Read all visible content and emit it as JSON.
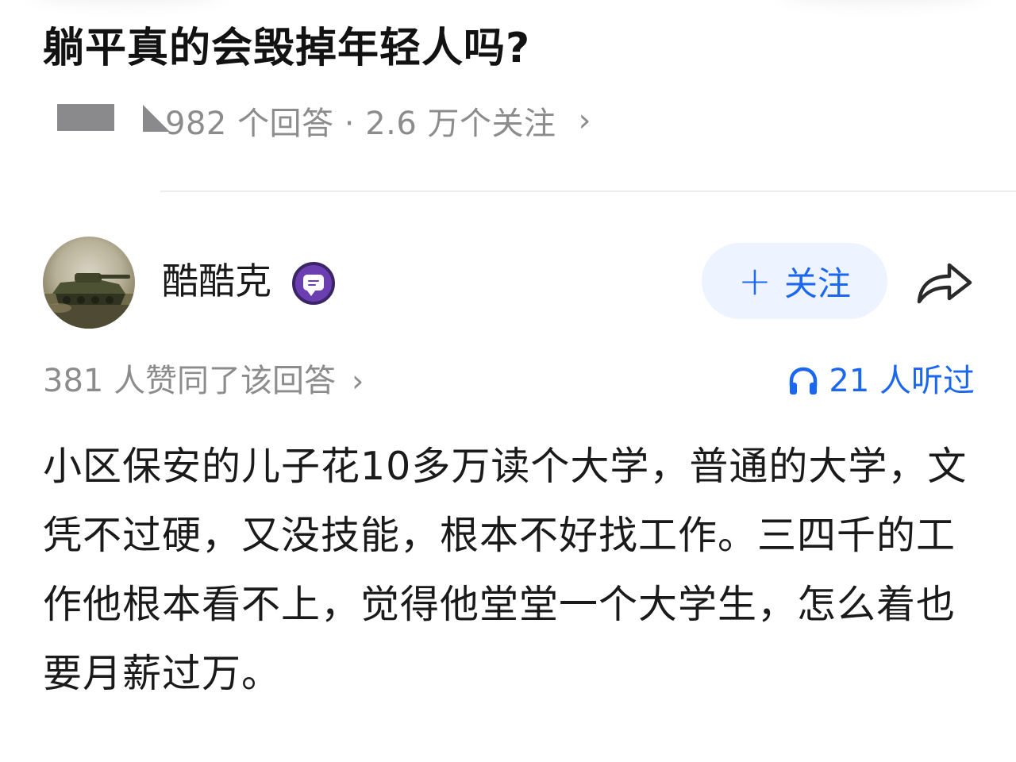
{
  "question": {
    "title": "躺平真的会毁掉年轻人吗?",
    "stats": "982 个回答 · 2.6 万个关注",
    "chevron": "›"
  },
  "author": {
    "name": "酷酷克",
    "badge_icon": "chat-badge-icon",
    "follow_plus": "+",
    "follow_label": "关注",
    "share_icon": "share-arrow-icon"
  },
  "answer": {
    "likes_text": "381 人赞同了该回答",
    "likes_chevron": "›",
    "listen_icon": "headphones-icon",
    "listen_text": "21 人听过",
    "body": "小区保安的儿子花10多万读个大学，普通的大学，文凭不过硬，又没技能，根本不好找工作。三四千的工作他根本看不上，觉得他堂堂一个大学生，怎么着也要月薪过万。"
  },
  "colors": {
    "accent": "#1b67f0",
    "follow_bg": "#eef4ff",
    "muted_text": "#8c8c8c",
    "badge_purple": "#6b3fb2",
    "redaction": "#8a8a8d"
  }
}
